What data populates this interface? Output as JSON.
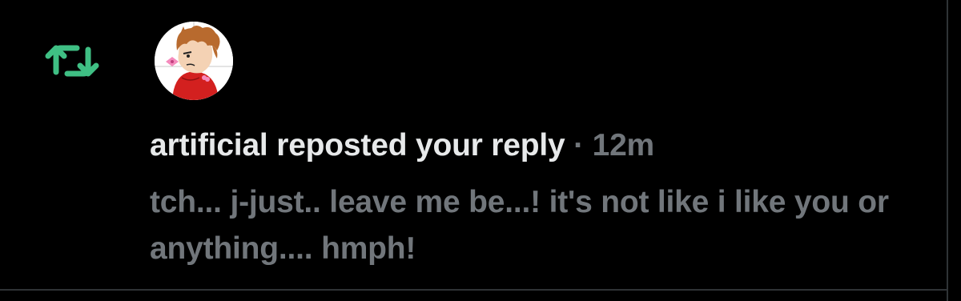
{
  "notification": {
    "type_icon": "repost-icon",
    "user_name": "artificial",
    "action_text": " reposted your reply",
    "separator": " · ",
    "time_ago": "12m",
    "reply_text": "tch... j-just.. leave me be...! it's not like i like you or anything.... hmph!"
  },
  "colors": {
    "background": "#000000",
    "repost_green": "#00ba7c",
    "primary_text": "#e7e9ea",
    "secondary_text": "#71767b",
    "divider": "#2f3336"
  }
}
